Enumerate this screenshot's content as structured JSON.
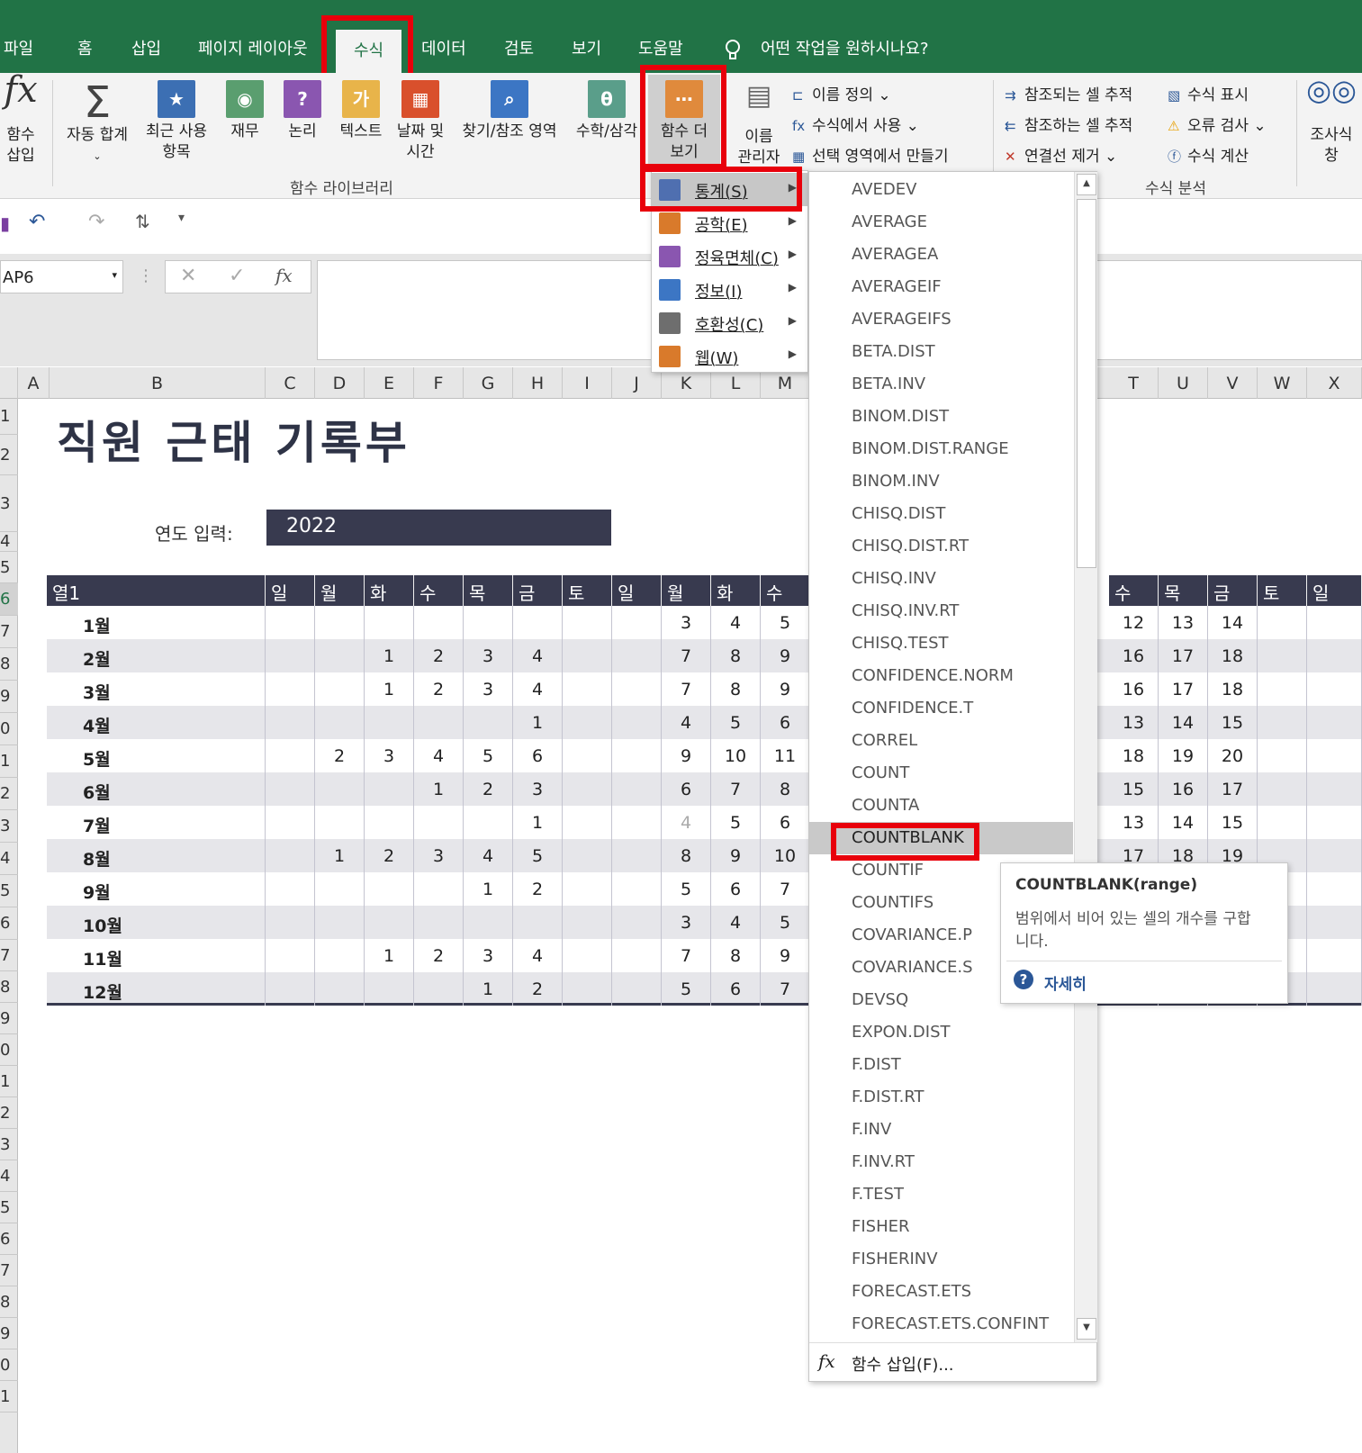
{
  "tabs": [
    "파일",
    "홈",
    "삽입",
    "페이지 레이아웃",
    "수식",
    "데이터",
    "검토",
    "보기",
    "도움말"
  ],
  "active_tab": "수식",
  "tell_me": "어떤 작업을 원하시나요?",
  "ribbon": {
    "insert_function": [
      "함수",
      "삽입"
    ],
    "autosum": "자동 합계",
    "recent": [
      "최근 사용",
      "항목"
    ],
    "financial": "재무",
    "logical": "논리",
    "text": "텍스트",
    "datetime": [
      "날짜 및",
      "시간"
    ],
    "lookup": "찾기/참조 영역",
    "math": "수학/삼각",
    "more": [
      "함수 더",
      "보기"
    ],
    "group_library": "함수 라이브러리",
    "name_manager": [
      "이름",
      "관리자"
    ],
    "define_name": "이름 정의",
    "use_in_formula": "수식에서 사용",
    "create_from_selection": "선택 영역에서 만들기",
    "trace_precedents": "참조되는 셀 추적",
    "trace_dependents": "참조하는 셀 추적",
    "remove_arrows": "연결선 제거",
    "show_formulas": "수식 표시",
    "error_checking": "오류 검사",
    "evaluate_formula": "수식 계산",
    "group_auditing": "수식 분석",
    "watch_window": [
      "조사식",
      "창"
    ]
  },
  "name_box": "AP6",
  "fx_label": "fx",
  "columns": [
    "A",
    "B",
    "C",
    "D",
    "E",
    "F",
    "G",
    "H",
    "I",
    "J",
    "K",
    "L",
    "M",
    "T",
    "U",
    "V",
    "W",
    "X"
  ],
  "rows": [
    "1",
    "2",
    "3",
    "4",
    "5",
    "6",
    "7",
    "8",
    "9",
    "0",
    "1",
    "2",
    "3",
    "4",
    "5",
    "6",
    "7",
    "8",
    "9",
    "0",
    "1",
    "2",
    "3",
    "4",
    "5",
    "6",
    "7",
    "8",
    "9",
    "0",
    "1"
  ],
  "sheet": {
    "title": "직원 근태 기록부",
    "year_label": "연도 입력:",
    "year_value": "2022",
    "header_left": [
      "열1",
      "일",
      "월",
      "화",
      "수",
      "목",
      "금",
      "토",
      "일",
      "월",
      "화",
      "수"
    ],
    "header_right": [
      "수",
      "목",
      "금",
      "토",
      "일"
    ],
    "rows": [
      {
        "month": "1월",
        "left": [
          "",
          "",
          "",
          "",
          "",
          "",
          "",
          "",
          "3",
          "4",
          "5"
        ],
        "right": [
          "12",
          "13",
          "14",
          "",
          ""
        ]
      },
      {
        "month": "2월",
        "left": [
          "",
          "",
          "1",
          "2",
          "3",
          "4",
          "",
          "",
          "7",
          "8",
          "9"
        ],
        "right": [
          "16",
          "17",
          "18",
          "",
          ""
        ]
      },
      {
        "month": "3월",
        "left": [
          "",
          "",
          "1",
          "2",
          "3",
          "4",
          "",
          "",
          "7",
          "8",
          "9"
        ],
        "right": [
          "16",
          "17",
          "18",
          "",
          ""
        ]
      },
      {
        "month": "4월",
        "left": [
          "",
          "",
          "",
          "",
          "",
          "1",
          "",
          "",
          "4",
          "5",
          "6"
        ],
        "right": [
          "13",
          "14",
          "15",
          "",
          ""
        ]
      },
      {
        "month": "5월",
        "left": [
          "",
          "2",
          "3",
          "4",
          "5",
          "6",
          "",
          "",
          "9",
          "10",
          "11"
        ],
        "right": [
          "18",
          "19",
          "20",
          "",
          ""
        ]
      },
      {
        "month": "6월",
        "left": [
          "",
          "",
          "",
          "1",
          "2",
          "3",
          "",
          "",
          "6",
          "7",
          "8"
        ],
        "right": [
          "15",
          "16",
          "17",
          "",
          ""
        ]
      },
      {
        "month": "7월",
        "left": [
          "",
          "",
          "",
          "",
          "",
          "1",
          "",
          "",
          "4",
          "5",
          "6"
        ],
        "right": [
          "13",
          "14",
          "15",
          "",
          ""
        ]
      },
      {
        "month": "8월",
        "left": [
          "",
          "1",
          "2",
          "3",
          "4",
          "5",
          "",
          "",
          "8",
          "9",
          "10"
        ],
        "right": [
          "17",
          "18",
          "19",
          "",
          ""
        ]
      },
      {
        "month": "9월",
        "left": [
          "",
          "",
          "",
          "",
          "1",
          "2",
          "",
          "",
          "5",
          "6",
          "7"
        ],
        "right": [
          "",
          "",
          "",
          "",
          ""
        ]
      },
      {
        "month": "10월",
        "left": [
          "",
          "",
          "",
          "",
          "",
          "",
          "",
          "",
          "3",
          "4",
          "5"
        ],
        "right": [
          "",
          "",
          "",
          "",
          ""
        ]
      },
      {
        "month": "11월",
        "left": [
          "",
          "",
          "1",
          "2",
          "3",
          "4",
          "",
          "",
          "7",
          "8",
          "9"
        ],
        "right": [
          "",
          "",
          "",
          "",
          ""
        ]
      },
      {
        "month": "12월",
        "left": [
          "",
          "",
          "",
          "",
          "1",
          "2",
          "",
          "",
          "5",
          "6",
          "7"
        ],
        "right": [
          "",
          "",
          "",
          "",
          ""
        ]
      }
    ]
  },
  "category_menu": [
    {
      "label": "통계(S)",
      "icon_color": "#4f6fb0"
    },
    {
      "label": "공학(E)",
      "icon_color": "#d97a2b"
    },
    {
      "label": "정육면체(C)",
      "icon_color": "#8a56b0"
    },
    {
      "label": "정보(I)",
      "icon_color": "#3c76c4"
    },
    {
      "label": "호환성(C)",
      "icon_color": "#6e6e6e"
    },
    {
      "label": "웹(W)",
      "icon_color": "#d97a2b"
    }
  ],
  "function_list": [
    "AVEDEV",
    "AVERAGE",
    "AVERAGEA",
    "AVERAGEIF",
    "AVERAGEIFS",
    "BETA.DIST",
    "BETA.INV",
    "BINOM.DIST",
    "BINOM.DIST.RANGE",
    "BINOM.INV",
    "CHISQ.DIST",
    "CHISQ.DIST.RT",
    "CHISQ.INV",
    "CHISQ.INV.RT",
    "CHISQ.TEST",
    "CONFIDENCE.NORM",
    "CONFIDENCE.T",
    "CORREL",
    "COUNT",
    "COUNTA",
    "COUNTBLANK",
    "COUNTIF",
    "COUNTIFS",
    "COVARIANCE.P",
    "COVARIANCE.S",
    "DEVSQ",
    "EXPON.DIST",
    "F.DIST",
    "F.DIST.RT",
    "F.INV",
    "F.INV.RT",
    "F.TEST",
    "FISHER",
    "FISHERINV",
    "FORECAST.ETS",
    "FORECAST.ETS.CONFINT"
  ],
  "highlighted_function": "COUNTBLANK",
  "insert_function_footer": "함수 삽입(F)...",
  "tooltip": {
    "signature": "COUNTBLANK(range)",
    "description": "범위에서 비어 있는 셀의 개수를 구합니다.",
    "more_link": "자세히"
  },
  "colors": {
    "excel_green": "#217346",
    "table_header": "#383a4f",
    "highlight_red": "#e8000b"
  }
}
